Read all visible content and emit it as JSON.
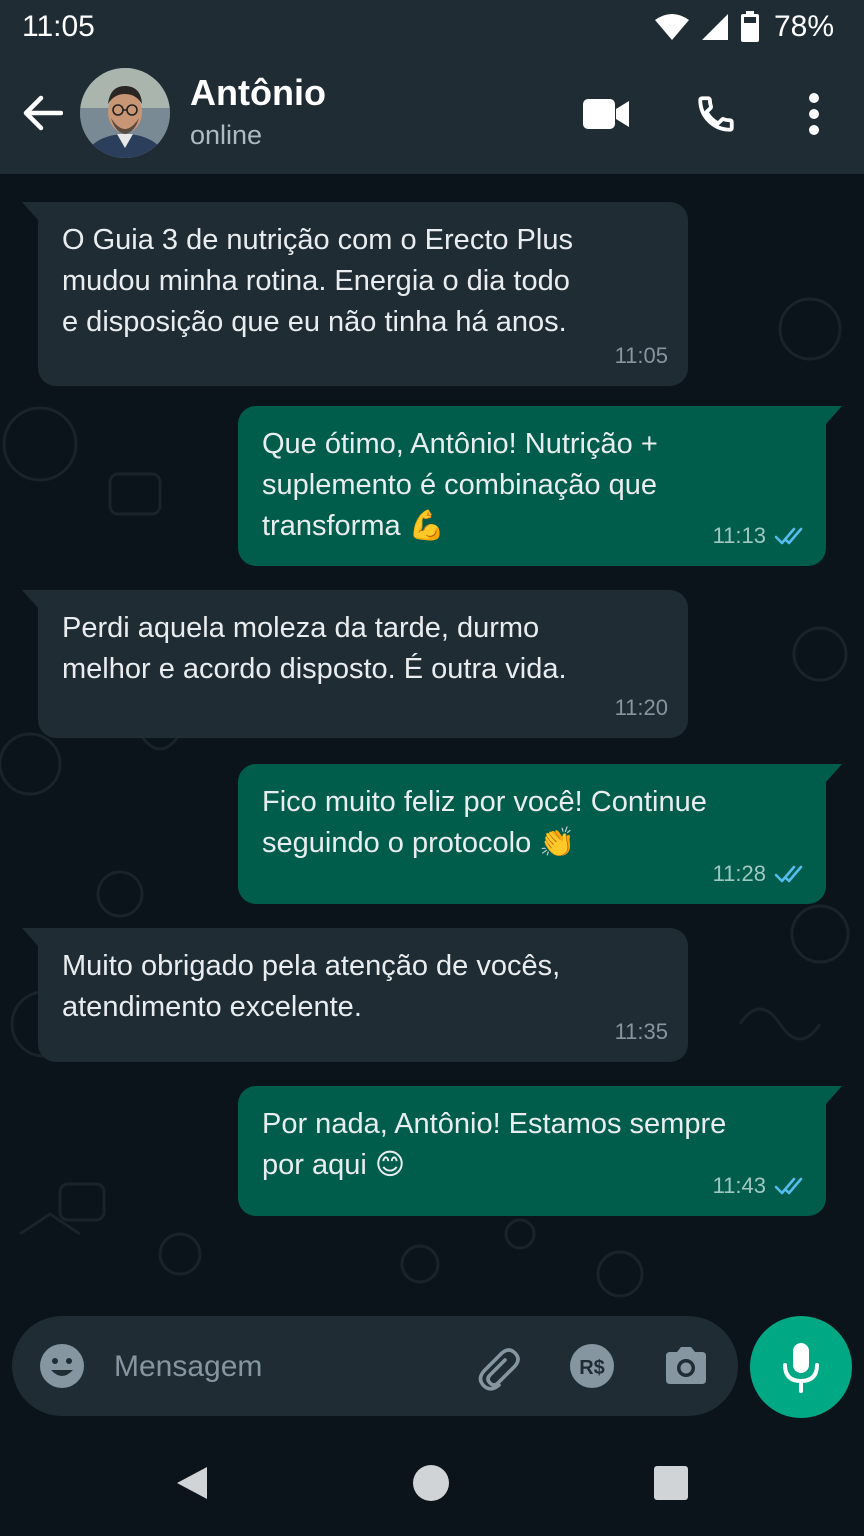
{
  "status_bar": {
    "time": "11:05",
    "battery": "78%"
  },
  "header": {
    "contact_name": "Antônio",
    "contact_status": "online"
  },
  "messages": [
    {
      "direction": "in",
      "text": "O Guia 3 de nutrição com o Erecto Plus\nmudou minha rotina. Energia o dia todo\ne disposição que eu não tinha há anos.",
      "time": "11:05"
    },
    {
      "direction": "out",
      "text": "Que ótimo, Antônio! Nutrição +\nsuplemento é combinação que\ntransforma 💪",
      "time": "11:13",
      "read": true
    },
    {
      "direction": "in",
      "text": "Perdi aquela moleza da tarde, durmo\nmelhor e acordo disposto. É outra vida.",
      "time": "11:20"
    },
    {
      "direction": "out",
      "text": "Fico muito feliz por você! Continue\nseguindo o protocolo 👏",
      "time": "11:28",
      "read": true
    },
    {
      "direction": "in",
      "text": "Muito obrigado pela atenção de vocês,\natendimento excelente.",
      "time": "11:35"
    },
    {
      "direction": "out",
      "text": "Por nada, Antônio! Estamos sempre\npor aqui 😊",
      "time": "11:43",
      "read": true
    }
  ],
  "input": {
    "placeholder": "Mensagem",
    "payment_label": "R$"
  },
  "colors": {
    "header_bg": "#1f2c34",
    "chat_bg": "#0b141a",
    "incoming_bubble": "#1f2c34",
    "outgoing_bubble": "#005c4b",
    "accent": "#00a884",
    "read_tick": "#53bdeb"
  },
  "icons": {
    "back": "arrow-left-icon",
    "video": "video-camera-icon",
    "call": "phone-icon",
    "menu": "more-vert-icon",
    "emoji": "emoji-icon",
    "attach": "paperclip-icon",
    "payment": "payment-icon",
    "camera": "camera-icon",
    "mic": "microphone-icon"
  }
}
